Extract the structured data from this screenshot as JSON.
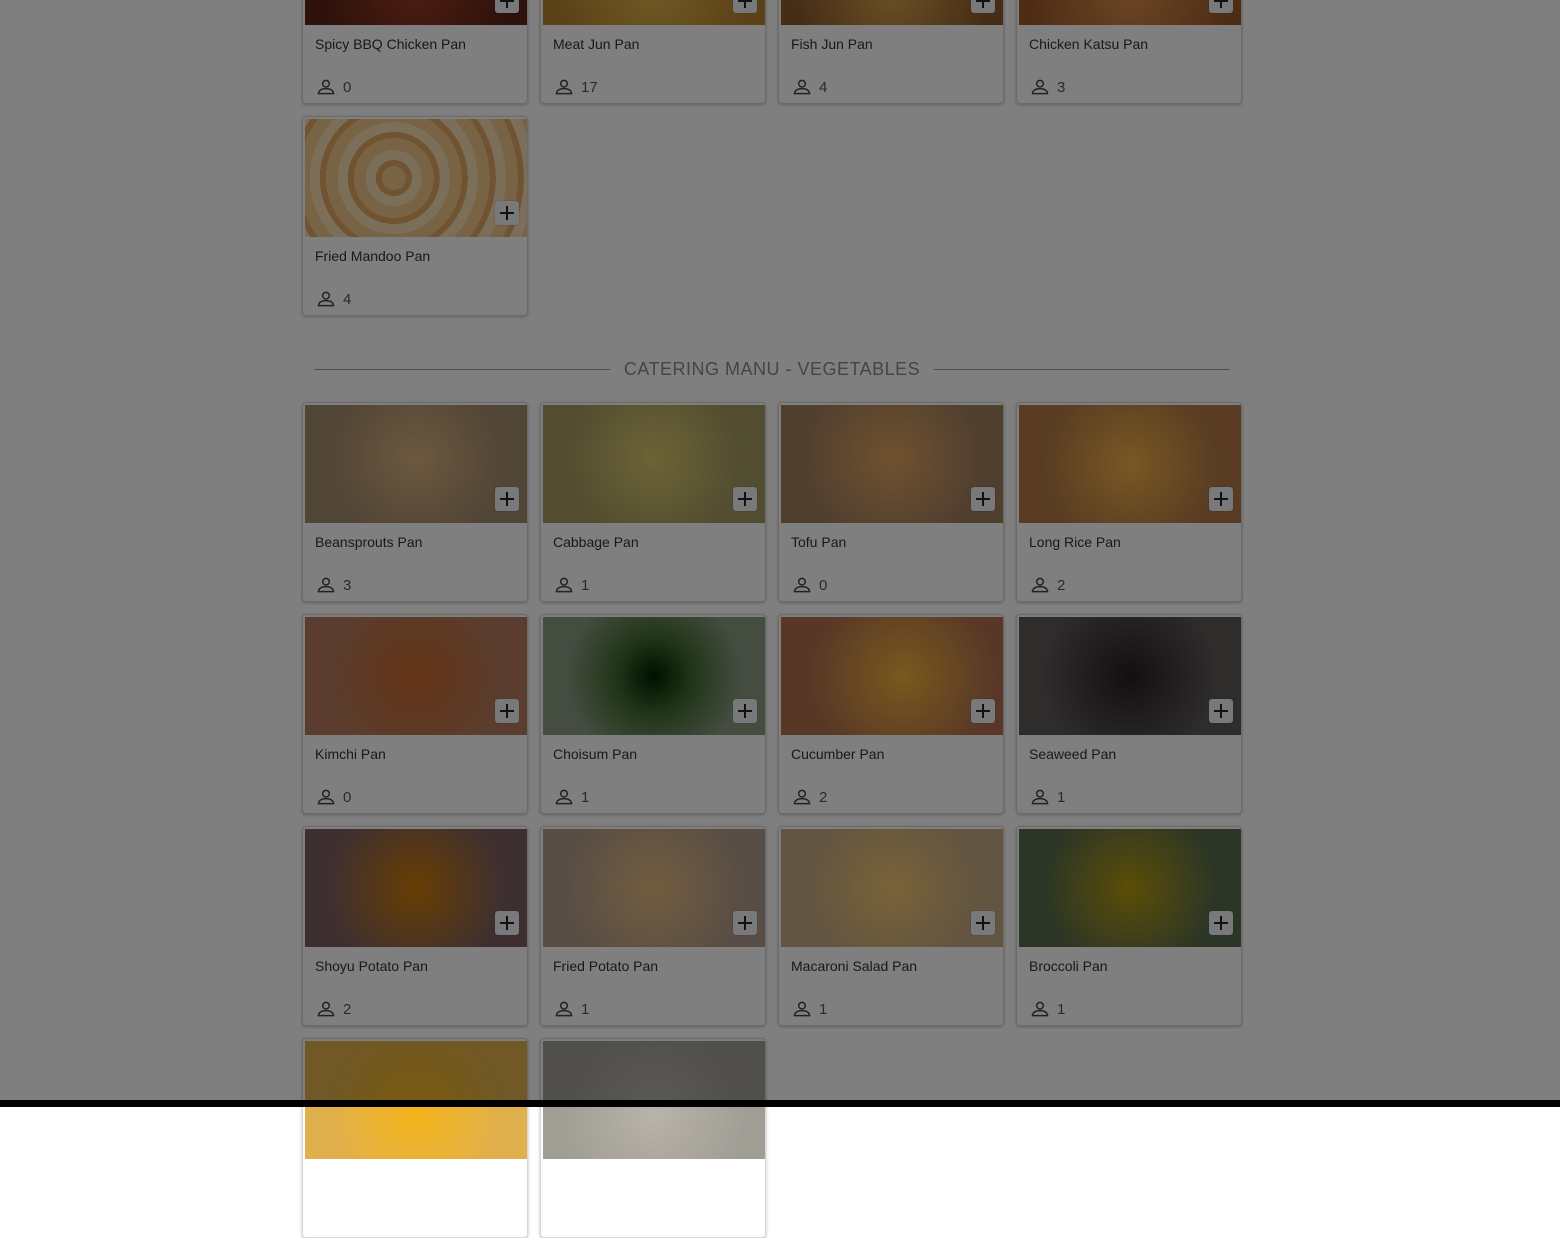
{
  "top_items": [
    {
      "name": "Spicy BBQ Chicken Pan",
      "count": "0"
    },
    {
      "name": "Meat Jun Pan",
      "count": "17"
    },
    {
      "name": "Fish Jun Pan",
      "count": "4"
    },
    {
      "name": "Chicken Katsu Pan",
      "count": "3"
    },
    {
      "name": "Fried Mandoo Pan",
      "count": "4"
    }
  ],
  "vegetables_section": {
    "title": "CATERING MANU - VEGETABLES",
    "items": [
      {
        "name": "Beansprouts Pan",
        "count": "3"
      },
      {
        "name": "Cabbage Pan",
        "count": "1"
      },
      {
        "name": "Tofu Pan",
        "count": "0"
      },
      {
        "name": "Long Rice Pan",
        "count": "2"
      },
      {
        "name": "Kimchi Pan",
        "count": "0"
      },
      {
        "name": "Choisum Pan",
        "count": "1"
      },
      {
        "name": "Cucumber Pan",
        "count": "2"
      },
      {
        "name": "Seaweed Pan",
        "count": "1"
      },
      {
        "name": "Shoyu Potato Pan",
        "count": "2"
      },
      {
        "name": "Fried Potato Pan",
        "count": "1"
      },
      {
        "name": "Macaroni Salad Pan",
        "count": "1"
      },
      {
        "name": "Broccoli Pan",
        "count": "1"
      }
    ]
  },
  "icons": {
    "add": "plus-icon",
    "people": "person-icon"
  }
}
